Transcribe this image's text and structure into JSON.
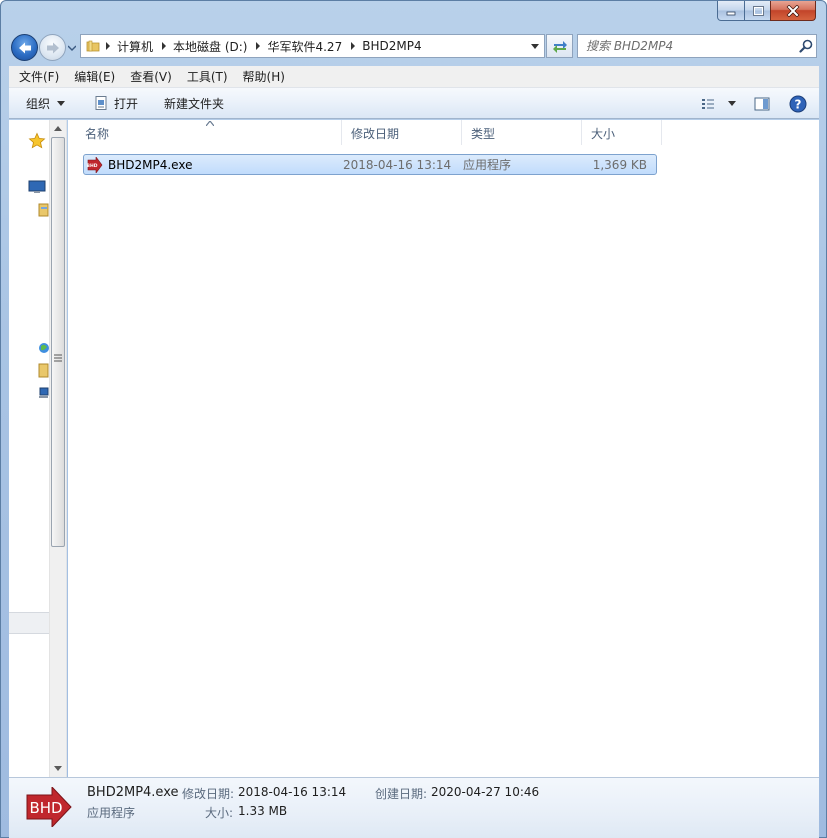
{
  "breadcrumbs": [
    "计算机",
    "本地磁盘 (D:)",
    "华军软件4.27",
    "BHD2MP4"
  ],
  "search": {
    "placeholder": "搜索 BHD2MP4"
  },
  "menu": [
    "文件(F)",
    "编辑(E)",
    "查看(V)",
    "工具(T)",
    "帮助(H)"
  ],
  "toolbar": {
    "organize": "组织",
    "open": "打开",
    "new_folder": "新建文件夹"
  },
  "columns": {
    "name": "名称",
    "date": "修改日期",
    "type": "类型",
    "size": "大小"
  },
  "files": [
    {
      "name": "BHD2MP4.exe",
      "modified": "2018-04-16 13:14",
      "type": "应用程序",
      "size": "1,369 KB",
      "selected": true
    }
  ],
  "details": {
    "filename": "BHD2MP4.exe",
    "filetype": "应用程序",
    "modified_label": "修改日期:",
    "modified": "2018-04-16 13:14",
    "created_label": "创建日期:",
    "created": "2020-04-27 10:46",
    "size_label": "大小:",
    "size": "1.33 MB",
    "icon_text": "BHD"
  },
  "colors": {
    "frame": "#a9c4e4",
    "selection": "#c1dcfc",
    "icon_red": "#c0272d",
    "close_red": "#c2442a"
  }
}
